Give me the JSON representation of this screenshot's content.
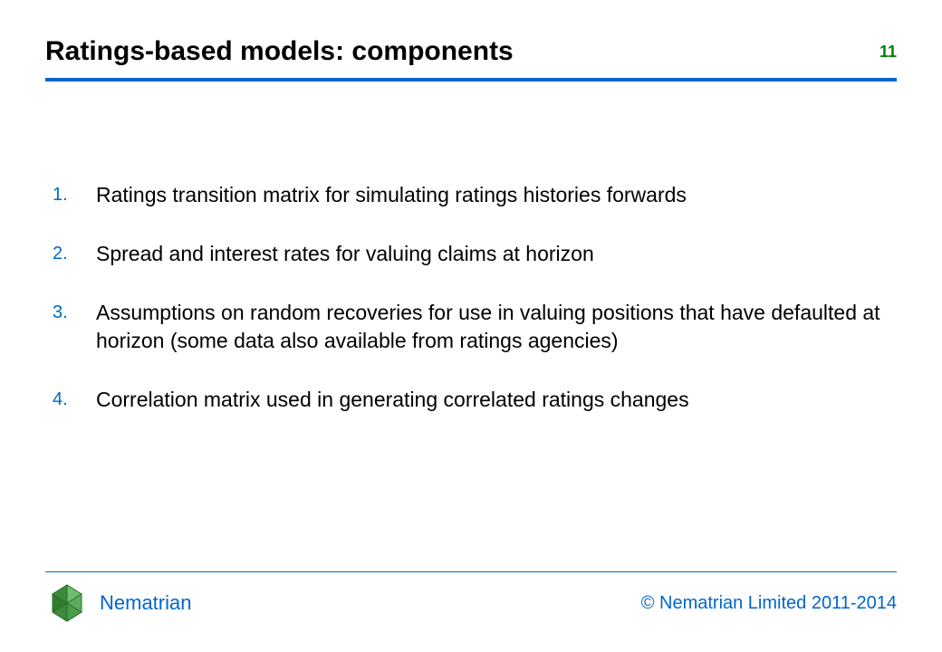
{
  "header": {
    "title": "Ratings-based models: components",
    "page_number": "11"
  },
  "content": {
    "items": [
      {
        "number": "1.",
        "text": "Ratings transition matrix for simulating ratings histories forwards"
      },
      {
        "number": "2.",
        "text": "Spread and interest rates for valuing claims at horizon"
      },
      {
        "number": "3.",
        "text": "Assumptions on random recoveries for use in valuing positions that have defaulted at horizon (some data also available from ratings agencies)"
      },
      {
        "number": "4.",
        "text": "Correlation matrix used in generating correlated ratings changes"
      }
    ]
  },
  "footer": {
    "brand": "Nematrian",
    "copyright": "© Nematrian Limited 2011-2014"
  },
  "colors": {
    "accent_blue": "#0066cc",
    "accent_green": "#008000",
    "text_black": "#000000"
  }
}
